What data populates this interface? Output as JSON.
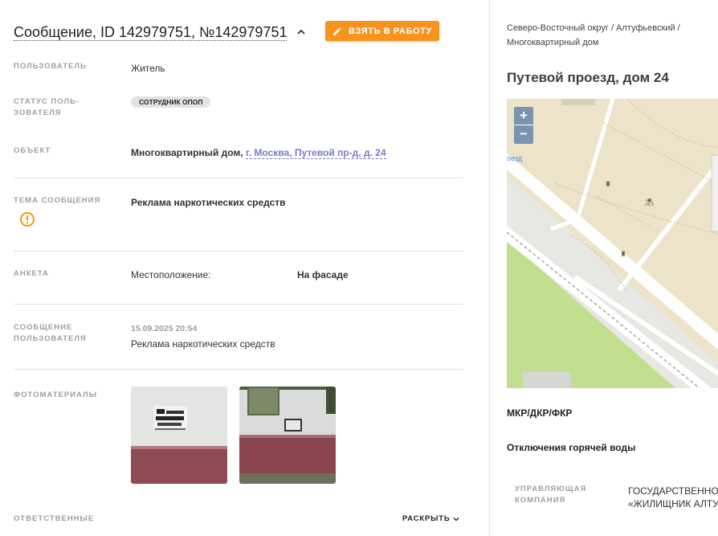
{
  "header": {
    "title": "Сообщение, ID 142979751, №142979751",
    "take_button_label": "ВЗЯТЬ В РАБОТУ"
  },
  "fields": {
    "user_label": "ПОЛЬЗОВАТЕЛЬ",
    "user_value": "Житель",
    "user_status_label_1": "СТАТУС ПОЛЬ-",
    "user_status_label_2": "ЗОВАТЕЛЯ",
    "user_status_badge": "СОТРУДНИК ОПОП",
    "object_label": "ОБЪЕКТ",
    "object_type": "Многоквартирный дом,",
    "object_link": "г. Москва, Путевой пр-д, д. 24",
    "topic_label": "ТЕМА СООБЩЕНИЯ",
    "topic_value": "Реклама наркотических средств",
    "form_label": "АНКЕТА",
    "form_key": "Местоположение:",
    "form_value": "На фасаде",
    "message_label_1": "СООБЩЕНИЕ",
    "message_label_2": "ПОЛЬЗОВАТЕЛЯ",
    "message_date": "15.09.2025 20:54",
    "message_text": "Реклама наркотических средств",
    "photos_label": "ФОТОМАТЕРИАЛЫ",
    "responsible_label": "ОТВЕТСТВЕННЫЕ",
    "reveal_label": "РАСКРЫТЬ"
  },
  "right": {
    "breadcrumb_1": "Северо-Восточный округ / Алтуфьевский /",
    "breadcrumb_2": "Многоквартирный дом",
    "address": "Путевой проезд, дом 24",
    "map_road_label": "оезд",
    "zoom_in": "+",
    "zoom_out": "−",
    "mkr": "МКР/ДКР/ФКР",
    "hot_water": "Отключения горячей воды",
    "mgmt_label_1": "УПРАВЛЯЮЩАЯ",
    "mgmt_label_2": "КОМПАНИЯ",
    "mgmt_value_1": "ГОСУДАРСТВЕННОЕ",
    "mgmt_value_2": "«ЖИЛИЩНИК АЛТУ"
  },
  "colors": {
    "accent": "#f7941d",
    "link": "#7b79c8",
    "label": "#9aa0a6",
    "map_land": "#ede3c9",
    "map_park": "#c2de8f",
    "map_road": "#ffffff"
  },
  "icons": {
    "chevron": "chevron-up-icon",
    "take_button": "pencil-icon",
    "topic": "warning-circle-icon",
    "reveal": "chevron-down-icon"
  }
}
